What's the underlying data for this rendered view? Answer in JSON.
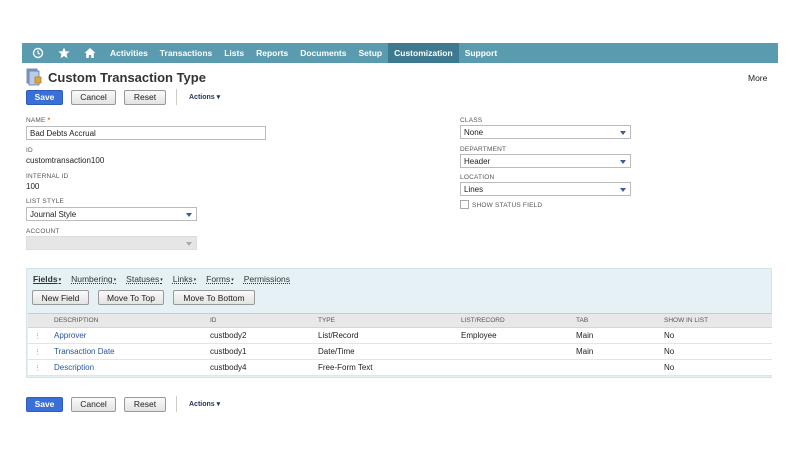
{
  "nav": {
    "icons": [
      "recent-icon",
      "star-icon",
      "home-icon"
    ],
    "items": [
      "Activities",
      "Transactions",
      "Lists",
      "Reports",
      "Documents",
      "Setup",
      "Customization",
      "Support"
    ],
    "active": "Customization"
  },
  "page": {
    "title": "Custom Transaction Type",
    "more": "More"
  },
  "buttons": {
    "save": "Save",
    "cancel": "Cancel",
    "reset": "Reset",
    "actions": "Actions ▾"
  },
  "form": {
    "name_label": "NAME",
    "name_value": "Bad Debts Accrual",
    "id_label": "ID",
    "id_value": "customtransaction100",
    "internal_id_label": "INTERNAL ID",
    "internal_id_value": "100",
    "list_style_label": "LIST STYLE",
    "list_style_value": "Journal Style",
    "account_label": "ACCOUNT",
    "account_value": "",
    "class_label": "CLASS",
    "class_value": "None",
    "department_label": "DEPARTMENT",
    "department_value": "Header",
    "location_label": "LOCATION",
    "location_value": "Lines",
    "show_status_label": "SHOW STATUS FIELD"
  },
  "subtabs": [
    {
      "label": "Fields",
      "dropdown": true,
      "active": true
    },
    {
      "label": "Numbering",
      "dropdown": true,
      "active": false
    },
    {
      "label": "Statuses",
      "dropdown": true,
      "active": false
    },
    {
      "label": "Links",
      "dropdown": true,
      "active": false
    },
    {
      "label": "Forms",
      "dropdown": true,
      "active": false
    },
    {
      "label": "Permissions",
      "dropdown": false,
      "active": false
    }
  ],
  "panel_buttons": {
    "new_field": "New Field",
    "move_to_top": "Move To Top",
    "move_to_bottom": "Move To Bottom"
  },
  "grid": {
    "columns": [
      "DESCRIPTION",
      "ID",
      "TYPE",
      "LIST/RECORD",
      "TAB",
      "SHOW IN LIST"
    ],
    "rows": [
      {
        "description": "Approver",
        "id": "custbody2",
        "type": "List/Record",
        "list_record": "Employee",
        "tab": "Main",
        "show_in_list": "No"
      },
      {
        "description": "Transaction Date",
        "id": "custbody1",
        "type": "Date/Time",
        "list_record": "",
        "tab": "Main",
        "show_in_list": "No"
      },
      {
        "description": "Description",
        "id": "custbody4",
        "type": "Free-Form Text",
        "list_record": "",
        "tab": "",
        "show_in_list": "No"
      }
    ]
  },
  "colors": {
    "nav_bg": "#5b9bb0",
    "nav_active": "#3e7a8f",
    "primary_button": "#3a6fd8",
    "link": "#2755a3",
    "subtab_panel": "#e5f1f4",
    "required_star": "#d96c00"
  }
}
